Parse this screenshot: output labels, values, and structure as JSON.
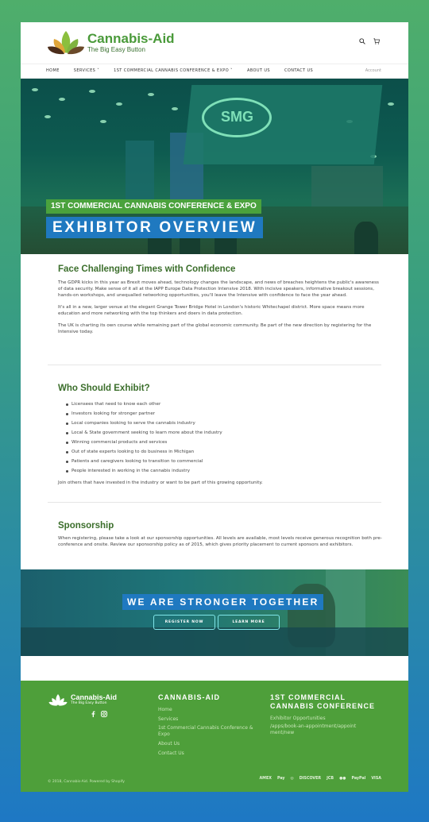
{
  "brand": {
    "title": "Cannabis-Aid",
    "tagline": "The Big Easy Button"
  },
  "nav": {
    "items": [
      "HOME",
      "SERVICES ˅",
      "1ST COMMERCIAL CANNABIS CONFERENCE & EXPO ˅",
      "ABOUT US",
      "CONTACT US"
    ],
    "account": "Account"
  },
  "hero": {
    "superscript_line": "1ST COMMERCIAL CANNABIS CONFERENCE & EXPO",
    "title": "EXHIBITOR OVERVIEW",
    "banner_text": "SMG"
  },
  "section1": {
    "heading": "Face Challenging Times with Confidence",
    "paragraphs": [
      "The GDPR kicks in this year as Brexit moves ahead, technology changes the landscape, and news of breaches heightens the public's awareness of data security. Make sense of it all at the IAPP Europe Data Protection Intensive 2018. With incisive speakers, informative breakout sessions, hands-on workshops, and unequalled networking opportunities, you'll leave the Intensive with confidence to face the year ahead.",
      "It's all in a new, larger venue at the elegant Grange Tower Bridge Hotel in London's historic Whitechapel district. More space means more education and more networking with the top thinkers and doers in data protection.",
      "The UK is charting its own course while remaining part of the global economic community. Be part of the new direction by registering for the Intensive today."
    ]
  },
  "section2": {
    "heading": "Who Should Exhibit?",
    "bullets": [
      "Licensees that need to know each other",
      "Investors looking for stronger partner",
      "Local companies looking to serve the cannabis industry",
      "Local & State government seeking to learn more about the industry",
      "Winning commercial products and services",
      "Out of state experts looking to do business in Michigan",
      "Patients and caregivers looking to transition to commercial",
      "People interested in working in the cannabis industry"
    ],
    "closing": "Join others that have invested in the industry or want to be part of this growing opportunity."
  },
  "section3": {
    "heading": "Sponsorship",
    "paragraph": "When registering, please take a look at our sponsorship opportunities. All levels are available, most levels receive generous recognition both pre-conference and onsite. Review our sponsorship policy as of 2015, which gives priority placement to current sponsors and exhibitors."
  },
  "cta": {
    "title": "WE ARE STRONGER TOGETHER",
    "register_label": "REGISTER NOW",
    "learn_label": "LEARN MORE"
  },
  "footer": {
    "brand_title": "Cannabis-Aid",
    "brand_tagline": "The Big Easy Button",
    "col1_title": "CANNABIS-AID",
    "col1_links": [
      "Home",
      "Services",
      "1st Commercial Cannabis Conference & Expo",
      "About Us",
      "Contact Us"
    ],
    "col2_title_line1": "1ST COMMERCIAL",
    "col2_title_line2": "CANNABIS CONFERENCE",
    "col2_links": [
      "Exhibitor Opportunities",
      "/apps/book-an-appointment/appointment/new"
    ],
    "copyright": "© 2018, Cannabis-Aid. Powered by Shopify",
    "payments": [
      "AMEX",
      "Pay",
      "◎",
      "DISCOVER",
      "JCB",
      "●●",
      "PayPal",
      "VISA"
    ]
  },
  "colors": {
    "brand_green": "#4e9f3a",
    "heading_green": "#3b6e2b",
    "accent_blue": "#1f79c0"
  }
}
